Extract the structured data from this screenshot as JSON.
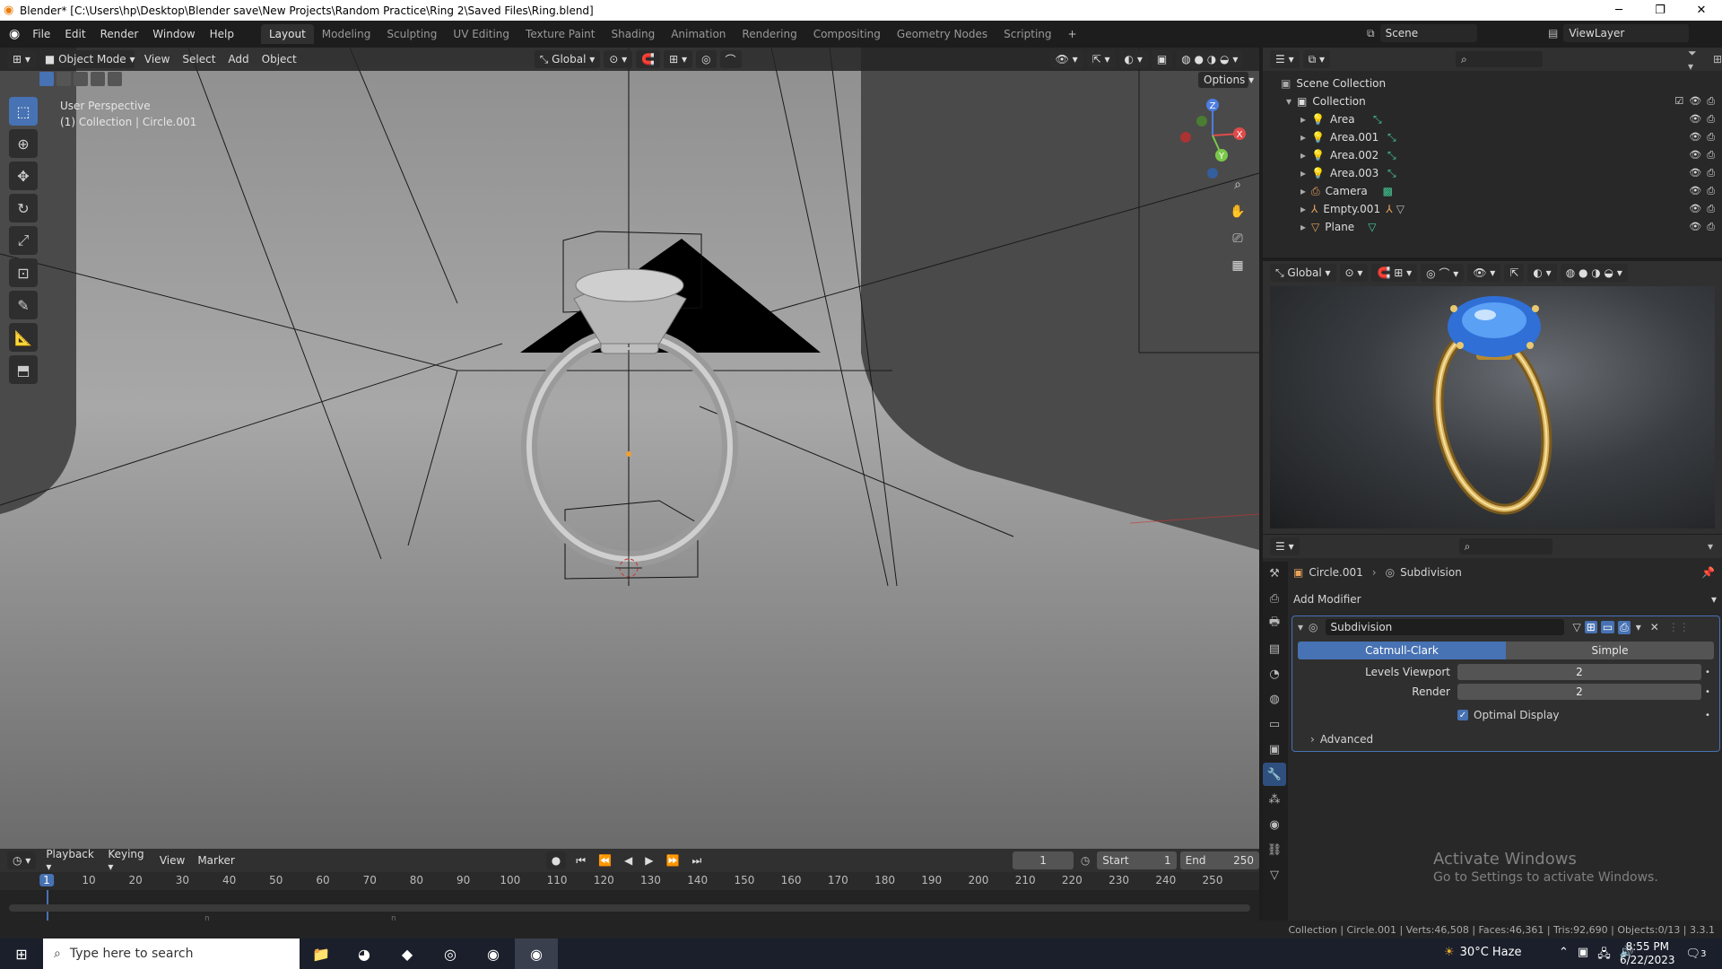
{
  "window": {
    "title": "Blender* [C:\\Users\\hp\\Desktop\\Blender save\\New Projects\\Random Practice\\Ring 2\\Saved Files\\Ring.blend]",
    "minimize": "─",
    "maximize": "❐",
    "close": "✕"
  },
  "menu": [
    "File",
    "Edit",
    "Render",
    "Window",
    "Help"
  ],
  "workspaces": [
    "Layout",
    "Modeling",
    "Sculpting",
    "UV Editing",
    "Texture Paint",
    "Shading",
    "Animation",
    "Rendering",
    "Compositing",
    "Geometry Nodes",
    "Scripting"
  ],
  "active_workspace": "Layout",
  "scene_name": "Scene",
  "view_layer": "ViewLayer",
  "viewport": {
    "mode": "Object Mode",
    "menus": [
      "View",
      "Select",
      "Add",
      "Object"
    ],
    "orientation": "Global",
    "options_label": "Options",
    "overlay_text1": "User Perspective",
    "overlay_text2": "(1) Collection | Circle.001",
    "axis_x": "X",
    "axis_y": "Y",
    "axis_z": "Z"
  },
  "outliner": {
    "scene_collection": "Scene Collection",
    "collection": "Collection",
    "items": [
      "Area",
      "Area.001",
      "Area.002",
      "Area.003",
      "Camera",
      "Empty.001",
      "Plane"
    ]
  },
  "render_view": {
    "orientation": "Global"
  },
  "properties": {
    "object": "Circle.001",
    "modifier_breadcrumb": "Subdivision",
    "add_modifier": "Add Modifier",
    "modifier_name": "Subdivision",
    "seg_catmull": "Catmull-Clark",
    "seg_simple": "Simple",
    "levels_viewport_label": "Levels Viewport",
    "levels_viewport_value": "2",
    "render_label": "Render",
    "render_value": "2",
    "optimal_display": "Optimal Display",
    "optimal_display_checked": true,
    "advanced": "Advanced"
  },
  "timeline": {
    "menus": [
      "Playback",
      "Keying",
      "View",
      "Marker"
    ],
    "current_frame": "1",
    "start_label": "Start",
    "start": "1",
    "end_label": "End",
    "end": "250",
    "ruler": [
      "1",
      "10",
      "20",
      "30",
      "40",
      "50",
      "60",
      "70",
      "80",
      "90",
      "100",
      "110",
      "120",
      "130",
      "140",
      "150",
      "160",
      "170",
      "180",
      "190",
      "200",
      "210",
      "220",
      "230",
      "240",
      "250"
    ]
  },
  "status": "Collection | Circle.001 | Verts:46,508 | Faces:46,361 | Tris:92,690 | Objects:0/13 | 3.3.1",
  "watermark": {
    "line1": "Activate Windows",
    "line2": "Go to Settings to activate Windows."
  },
  "taskbar": {
    "search_placeholder": "Type here to search",
    "weather": "30°C  Haze",
    "time": "8:55 PM",
    "date": "6/22/2023",
    "notif_count": "3"
  },
  "colors": {
    "accent": "#4772b3",
    "gem": "#2f6fd6",
    "gold": "#d8b25a"
  }
}
